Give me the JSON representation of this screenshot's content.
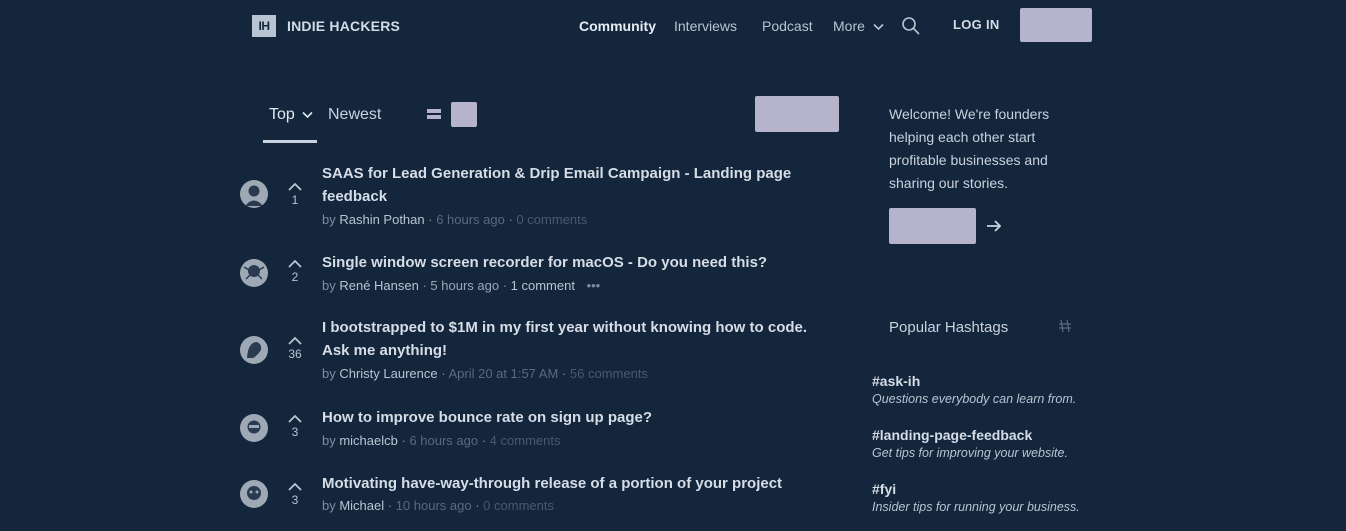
{
  "header": {
    "logo_mark": "IH",
    "logo_text": "INDIE HACKERS",
    "nav": [
      {
        "label": "Community"
      },
      {
        "label": "Interviews"
      },
      {
        "label": "Podcast"
      },
      {
        "label": "More"
      }
    ],
    "login_label": "LOG IN"
  },
  "feed": {
    "sort_top": "Top",
    "sort_newest": "Newest"
  },
  "posts": [
    {
      "title": "SAAS for Lead Generation & Drip Email Campaign - Landing page feedback",
      "author": "Rashin Pothan",
      "time": "6 hours ago",
      "comments": "0 comments",
      "votes": "1"
    },
    {
      "title": "Single window screen recorder for macOS - Do you need this?",
      "author": "René Hansen",
      "time": "5 hours ago",
      "comments": "1 comment",
      "votes": "2"
    },
    {
      "title": "I bootstrapped to $1M in my first year without knowing how to code. Ask me anything!",
      "author": "Christy Laurence",
      "time": "April 20 at 1:57 AM",
      "comments": "56 comments",
      "votes": "36"
    },
    {
      "title": "How to improve bounce rate on sign up page?",
      "author": "michaelcb",
      "time": "6 hours ago",
      "comments": "4 comments",
      "votes": "3"
    },
    {
      "title": "Motivating have-way-through release of a portion of your project",
      "author": "Michael",
      "time": "10 hours ago",
      "comments": "0 comments",
      "votes": "3"
    }
  ],
  "sidebar": {
    "welcome": "Welcome! We're founders helping each other start profitable businesses and sharing our stories.",
    "hashtags_title": "Popular Hashtags",
    "hashtags": [
      {
        "name": "#ask-ih",
        "desc": "Questions everybody can learn from."
      },
      {
        "name": "#landing-page-feedback",
        "desc": "Get tips for improving your website."
      },
      {
        "name": "#fyi",
        "desc": "Insider tips for running your business."
      }
    ]
  }
}
